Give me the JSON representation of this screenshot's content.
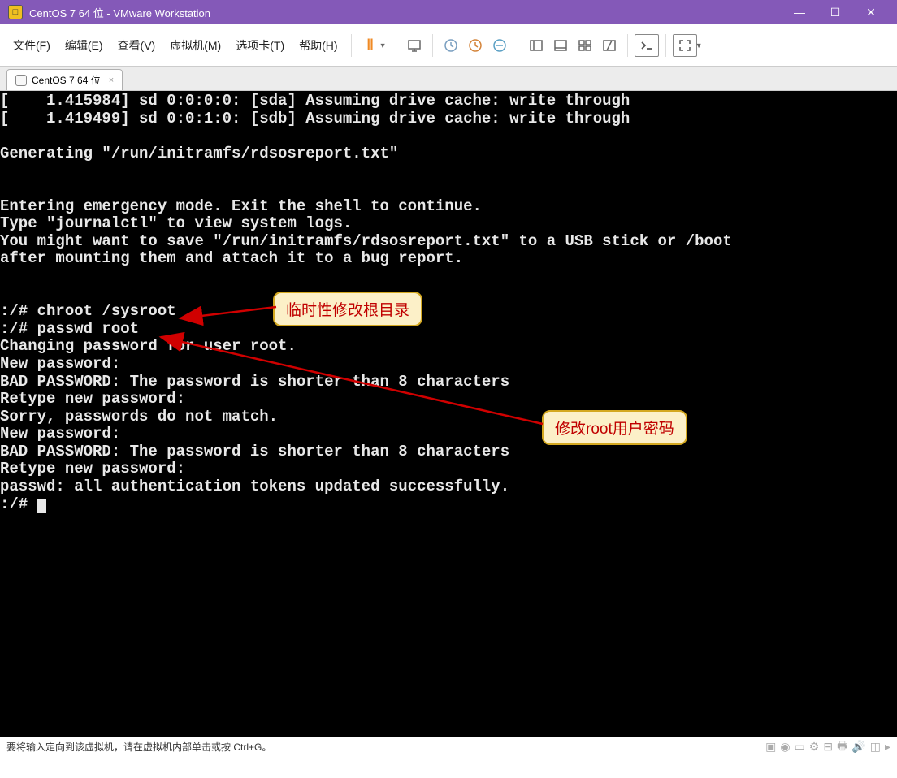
{
  "titlebar": {
    "title": "CentOS 7 64 位 - VMware Workstation"
  },
  "menu": {
    "file": "文件(F)",
    "edit": "编辑(E)",
    "view": "查看(V)",
    "vm": "虚拟机(M)",
    "tabs": "选项卡(T)",
    "help": "帮助(H)"
  },
  "tab": {
    "label": "CentOS 7 64 位"
  },
  "terminal": {
    "lines": [
      "[    1.415984] sd 0:0:0:0: [sda] Assuming drive cache: write through",
      "[    1.419499] sd 0:0:1:0: [sdb] Assuming drive cache: write through",
      "",
      "Generating \"/run/initramfs/rdsosreport.txt\"",
      "",
      "",
      "Entering emergency mode. Exit the shell to continue.",
      "Type \"journalctl\" to view system logs.",
      "You might want to save \"/run/initramfs/rdsosreport.txt\" to a USB stick or /boot",
      "after mounting them and attach it to a bug report.",
      "",
      "",
      ":/# chroot /sysroot",
      ":/# passwd root",
      "Changing password for user root.",
      "New password: ",
      "BAD PASSWORD: The password is shorter than 8 characters",
      "Retype new password: ",
      "Sorry, passwords do not match.",
      "New password: ",
      "BAD PASSWORD: The password is shorter than 8 characters",
      "Retype new password: ",
      "passwd: all authentication tokens updated successfully.",
      ":/# "
    ]
  },
  "callouts": {
    "c1": "临时性修改根目录",
    "c2": "修改root用户密码"
  },
  "statusbar": {
    "hint": "要将输入定向到该虚拟机，请在虚拟机内部单击或按 Ctrl+G。"
  },
  "icons": {
    "minimize": "—",
    "maximize": "☐",
    "close": "✕",
    "tab_close": "×"
  }
}
